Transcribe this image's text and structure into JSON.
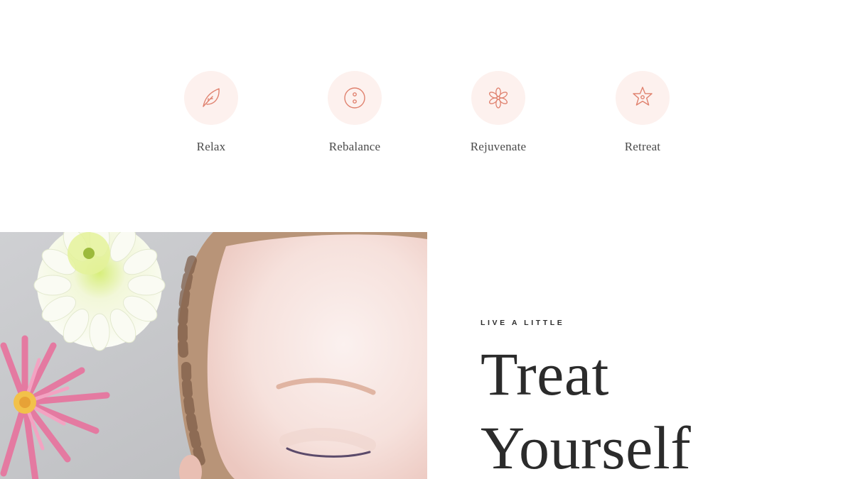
{
  "features": [
    {
      "label": "Relax",
      "icon": "leaf-icon"
    },
    {
      "label": "Rebalance",
      "icon": "button-icon"
    },
    {
      "label": "Rejuvenate",
      "icon": "flower-icon"
    },
    {
      "label": "Retreat",
      "icon": "star-icon"
    }
  ],
  "hero": {
    "eyebrow": "LIVE A LITTLE",
    "headline_line1": "Treat",
    "headline_line2": "Yourself"
  },
  "colors": {
    "accent": "#e0826f",
    "icon_circle_bg": "#fdf1ee",
    "text_dark": "#2b2b2b"
  }
}
